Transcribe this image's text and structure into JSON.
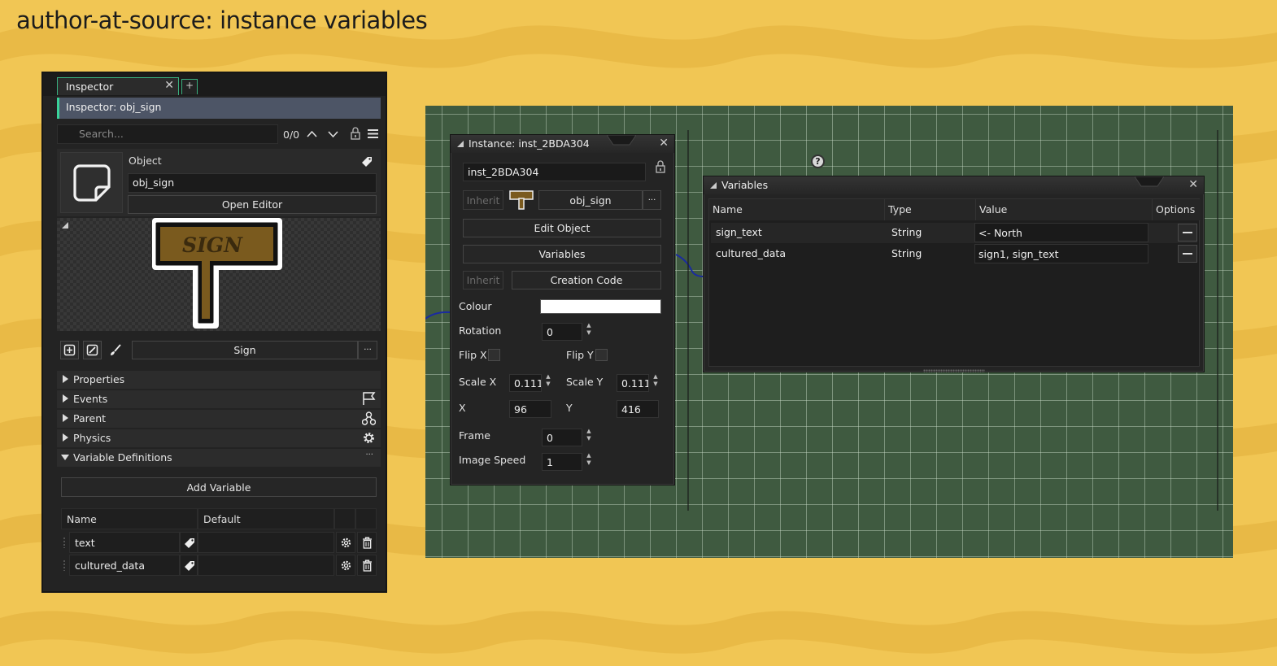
{
  "page": {
    "title": "author-at-source: instance variables"
  },
  "inspector": {
    "tab_label": "Inspector",
    "tab_close": "✕",
    "tab_add": "+",
    "title": "Inspector: obj_sign",
    "search_placeholder": "Search...",
    "search_count": "0/0",
    "object_label": "Object",
    "object_name": "obj_sign",
    "open_editor": "Open Editor",
    "sprite_name": "Sign",
    "sprite_more": "···",
    "sections": {
      "properties": "Properties",
      "events": "Events",
      "parent": "Parent",
      "physics": "Physics",
      "variable_definitions": "Variable Definitions",
      "more": "···"
    },
    "add_variable": "Add Variable",
    "var_table": {
      "headers": {
        "name": "Name",
        "default": "Default"
      },
      "rows": [
        {
          "name": "text",
          "default": ""
        },
        {
          "name": "cultured_data",
          "default": ""
        }
      ]
    },
    "sprite_text": "SIGN"
  },
  "instance": {
    "title": "Instance: inst_2BDA304",
    "close": "✕",
    "name": "inst_2BDA304",
    "inherit": "Inherit",
    "object_name": "obj_sign",
    "more": "···",
    "edit_object": "Edit Object",
    "variables": "Variables",
    "creation_code": "Creation Code",
    "colour_label": "Colour",
    "colour_value": "#ffffff",
    "rotation_label": "Rotation",
    "rotation": "0",
    "flip_x_label": "Flip X",
    "flip_y_label": "Flip Y",
    "flip_x": false,
    "flip_y": false,
    "scale_x_label": "Scale X",
    "scale_x": "0.111",
    "scale_y_label": "Scale Y",
    "scale_y": "0.111",
    "x_label": "X",
    "x": "96",
    "y_label": "Y",
    "y": "416",
    "frame_label": "Frame",
    "frame": "0",
    "image_speed_label": "Image Speed",
    "image_speed": "1"
  },
  "variables_panel": {
    "title": "Variables",
    "close": "✕",
    "headers": {
      "name": "Name",
      "type": "Type",
      "value": "Value",
      "options": "Options"
    },
    "rows": [
      {
        "name": "sign_text",
        "type": "String",
        "value": "<- North"
      },
      {
        "name": "cultured_data",
        "type": "String",
        "value": "sign1, sign_text"
      }
    ]
  },
  "help_icon_text": "?",
  "colors": {
    "background": "#efc24f",
    "accent": "#39d39a",
    "room_bg": "#3f5a40",
    "sign_wood": "#7a5a1e"
  }
}
